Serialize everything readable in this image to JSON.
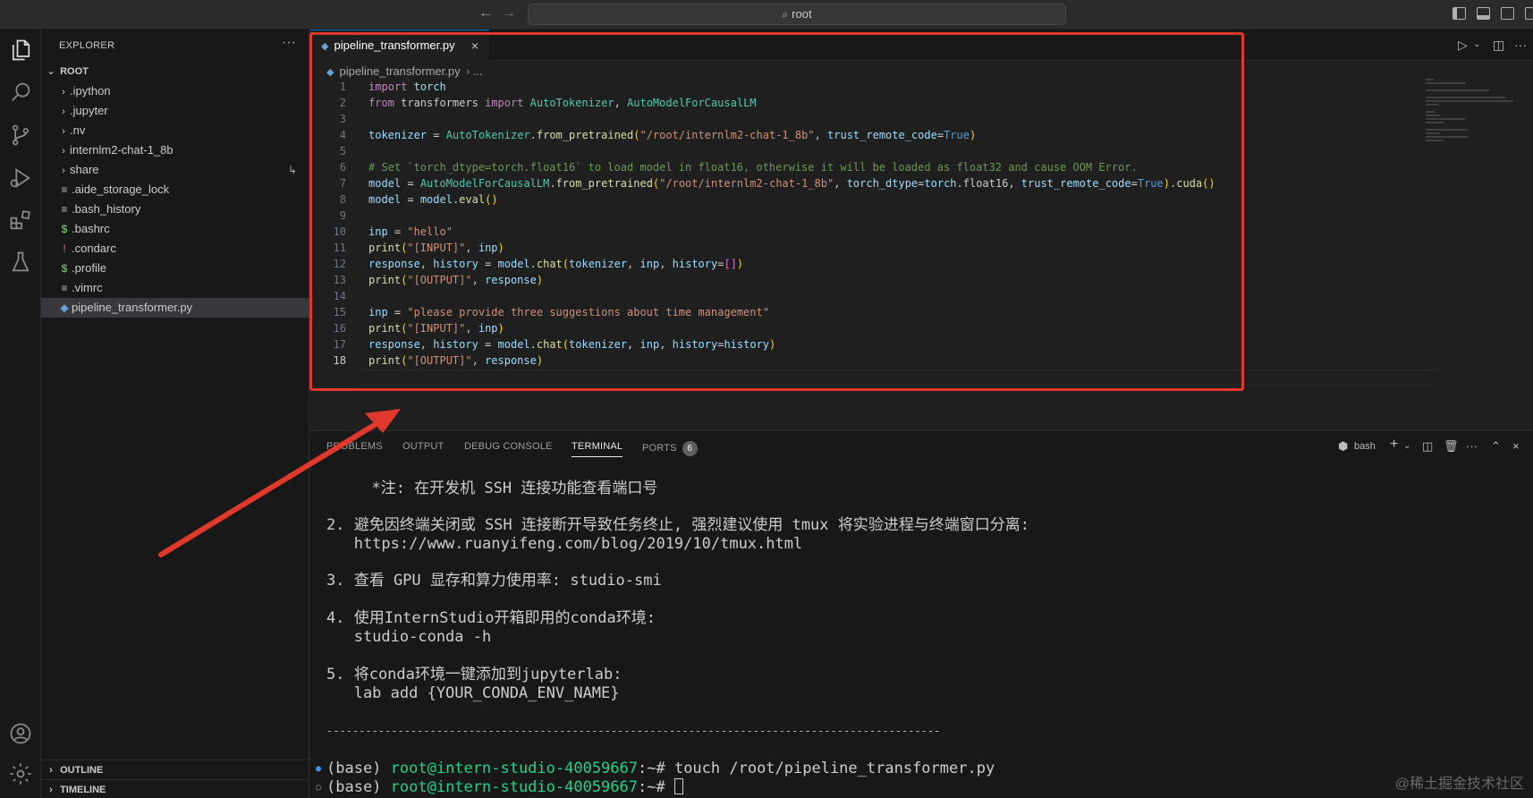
{
  "titlebar": {
    "search_text": "root",
    "back_icon": "arrow-left-icon",
    "forward_icon": "arrow-right-icon"
  },
  "activity_bar": [
    "explorer-icon",
    "search-icon",
    "source-control-icon",
    "run-debug-icon",
    "extensions-icon",
    "testing-icon",
    "account-icon",
    "settings-gear-icon"
  ],
  "explorer": {
    "title": "EXPLORER",
    "more": "···",
    "root_label": "ROOT",
    "items": [
      {
        "label": ".ipython",
        "type": "folder"
      },
      {
        "label": ".jupyter",
        "type": "folder"
      },
      {
        "label": ".nv",
        "type": "folder"
      },
      {
        "label": "internlm2-chat-1_8b",
        "type": "folder"
      },
      {
        "label": "share",
        "type": "folder"
      },
      {
        "label": ".aide_storage_lock",
        "type": "file",
        "icon": "≡"
      },
      {
        "label": ".bash_history",
        "type": "file",
        "icon": "≡"
      },
      {
        "label": ".bashrc",
        "type": "file",
        "icon": "$"
      },
      {
        "label": ".condarc",
        "type": "file",
        "icon": "!"
      },
      {
        "label": ".profile",
        "type": "file",
        "icon": "$"
      },
      {
        "label": ".vimrc",
        "type": "file",
        "icon": "≡"
      },
      {
        "label": "pipeline_transformer.py",
        "type": "python",
        "icon": "◆"
      }
    ],
    "outline_label": "OUTLINE",
    "timeline_label": "TIMELINE"
  },
  "editor": {
    "tab_label": "pipeline_transformer.py",
    "breadcrumb_file": "pipeline_transformer.py",
    "breadcrumb_rest": "...",
    "current_line": 18,
    "lines": [
      "import torch",
      "from transformers import AutoTokenizer, AutoModelForCausalLM",
      "",
      "tokenizer = AutoTokenizer.from_pretrained(\"/root/internlm2-chat-1_8b\", trust_remote_code=True)",
      "",
      "# Set `torch_dtype=torch.float16` to load model in float16, otherwise it will be loaded as float32 and cause OOM Error.",
      "model = AutoModelForCausalLM.from_pretrained(\"/root/internlm2-chat-1_8b\", torch_dtype=torch.float16, trust_remote_code=True).cuda()",
      "model = model.eval()",
      "",
      "inp = \"hello\"",
      "print(\"[INPUT]\", inp)",
      "response, history = model.chat(tokenizer, inp, history=[])",
      "print(\"[OUTPUT]\", response)",
      "",
      "inp = \"please provide three suggestions about time management\"",
      "print(\"[INPUT]\", inp)",
      "response, history = model.chat(tokenizer, inp, history=history)",
      "print(\"[OUTPUT]\", response)"
    ]
  },
  "panel": {
    "tabs": [
      "PROBLEMS",
      "OUTPUT",
      "DEBUG CONSOLE",
      "TERMINAL",
      "PORTS"
    ],
    "active_tab": "TERMINAL",
    "ports_badge": "6",
    "shell_label": "bash"
  },
  "terminal": {
    "lines": [
      "  *注: 在开发机 SSH 连接功能查看端口号",
      "2. 避免因终端关闭或 SSH 连接断开导致任务终止, 强烈建议使用 tmux 将实验进程与终端窗口分离:",
      "   https://www.ruanyifeng.com/blog/2019/10/tmux.html",
      "3. 查看 GPU 显存和算力使用率: studio-smi",
      "4. 使用InternStudio开箱即用的conda环境:",
      "   studio-conda -h",
      "5. 将conda环境一键添加到jupyterlab:",
      "   lab add {YOUR_CONDA_ENV_NAME}",
      "-----------------------------------------------------------------------------------------------"
    ],
    "prompt_prefix": "(base) ",
    "prompt_user": "root@intern-studio-40059667",
    "prompt_path": ":~# ",
    "command1": "touch /root/pipeline_transformer.py",
    "command2": ""
  },
  "watermark": "@稀土掘金技术社区",
  "colors": {
    "annotation_red": "#e0382b",
    "accent_blue": "#0078d4",
    "prompt_green": "#23d18b"
  }
}
